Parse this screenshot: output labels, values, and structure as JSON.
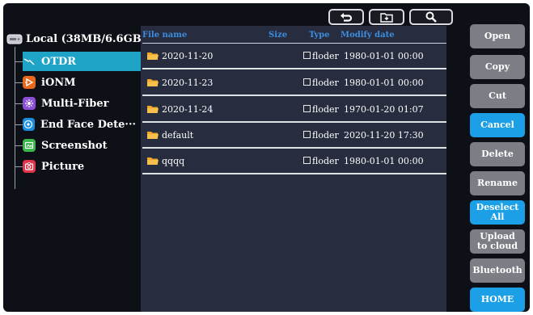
{
  "toolbar": {
    "back_icon": "return-arrow-icon",
    "newfolder_icon": "new-folder-icon",
    "search_icon": "search-icon"
  },
  "tree": {
    "root_label": "Local (38MB/6.6GB)",
    "items": [
      {
        "label": "OTDR",
        "icon": "otdr-icon",
        "color": "#1fa3c6",
        "selected": true
      },
      {
        "label": "iONM",
        "icon": "ionm-icon",
        "color": "#e56a1e",
        "selected": false
      },
      {
        "label": "Multi-Fiber",
        "icon": "multi-fiber-icon",
        "color": "#8a4fd6",
        "selected": false
      },
      {
        "label": "End Face Dete···",
        "icon": "end-face-icon",
        "color": "#1a8fdf",
        "selected": false
      },
      {
        "label": "Screenshot",
        "icon": "screenshot-icon",
        "color": "#3ab54a",
        "selected": false
      },
      {
        "label": "Picture",
        "icon": "picture-icon",
        "color": "#e0344a",
        "selected": false
      }
    ]
  },
  "filelist": {
    "headers": {
      "name": "File name",
      "size": "Size",
      "type": "Type",
      "date": "Modify date"
    },
    "rows": [
      {
        "name": "2020-11-20",
        "type": "floder",
        "date": "1980-01-01 00:00"
      },
      {
        "name": "2020-11-23",
        "type": "floder",
        "date": "1980-01-01 00:00"
      },
      {
        "name": "2020-11-24",
        "type": "floder",
        "date": "1970-01-20 01:07"
      },
      {
        "name": "default",
        "type": "floder",
        "date": "2020-11-20 17:30"
      },
      {
        "name": "qqqq",
        "type": "floder",
        "date": "1980-01-01 00:00"
      }
    ]
  },
  "actions": {
    "open": "Open",
    "copy": "Copy",
    "cut": "Cut",
    "cancel": "Cancel",
    "delete": "Delete",
    "rename": "Rename",
    "deselect_all_1": "Deselect",
    "deselect_all_2": "All",
    "upload_1": "Upload",
    "upload_2": "to cloud",
    "bluetooth": "Bluetooth",
    "home": "HOME"
  },
  "colors": {
    "accent_blue": "#1b9fe6",
    "selected_teal": "#1fa3c6",
    "button_gray": "#7b7e84",
    "panel": "#272c3f",
    "background": "#0e1018"
  }
}
